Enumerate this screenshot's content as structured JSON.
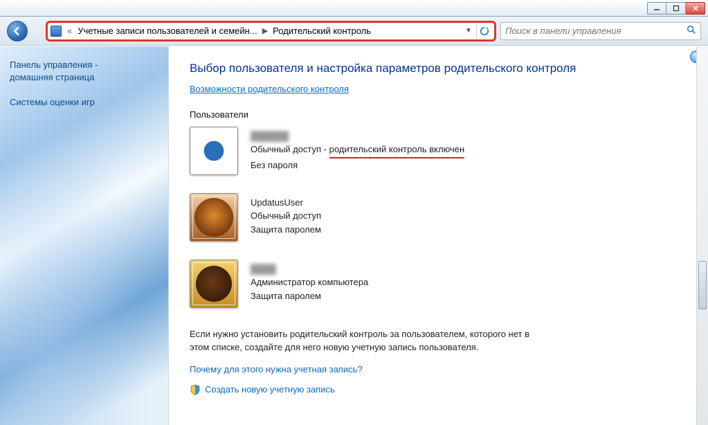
{
  "window_buttons": {
    "min": "min",
    "max": "max",
    "close": "close"
  },
  "nav": {
    "breadcrumb_prefix": "«",
    "breadcrumb_1": "Учетные записи пользователей и семейн...",
    "breadcrumb_2": "Родительский контроль"
  },
  "search": {
    "placeholder": "Поиск в панели управления"
  },
  "sidebar": {
    "home_line1": "Панель управления -",
    "home_line2": "домашняя страница",
    "ratings": "Системы оценки игр"
  },
  "page": {
    "title": "Выбор пользователя и настройка параметров родительского контроля",
    "capabilities_link": "Возможности родительского контроля",
    "users_label": "Пользователи",
    "users": [
      {
        "name_hidden": true,
        "access": "Обычный доступ",
        "pc_sep": " - ",
        "pc_status": "родительский контроль включен",
        "password": "Без пароля"
      },
      {
        "name": "UpdatusUser",
        "access": "Обычный доступ",
        "password": "Защита паролем"
      },
      {
        "name_hidden": true,
        "access": "Администратор компьютера",
        "password": "Защита паролем"
      }
    ],
    "bottom_text": "Если нужно установить родительский контроль за пользователем, которого нет в этом списке, создайте для него новую учетную запись пользователя.",
    "why_link": "Почему для этого нужна учетная запись?",
    "create_link": "Создать новую учетную запись"
  }
}
